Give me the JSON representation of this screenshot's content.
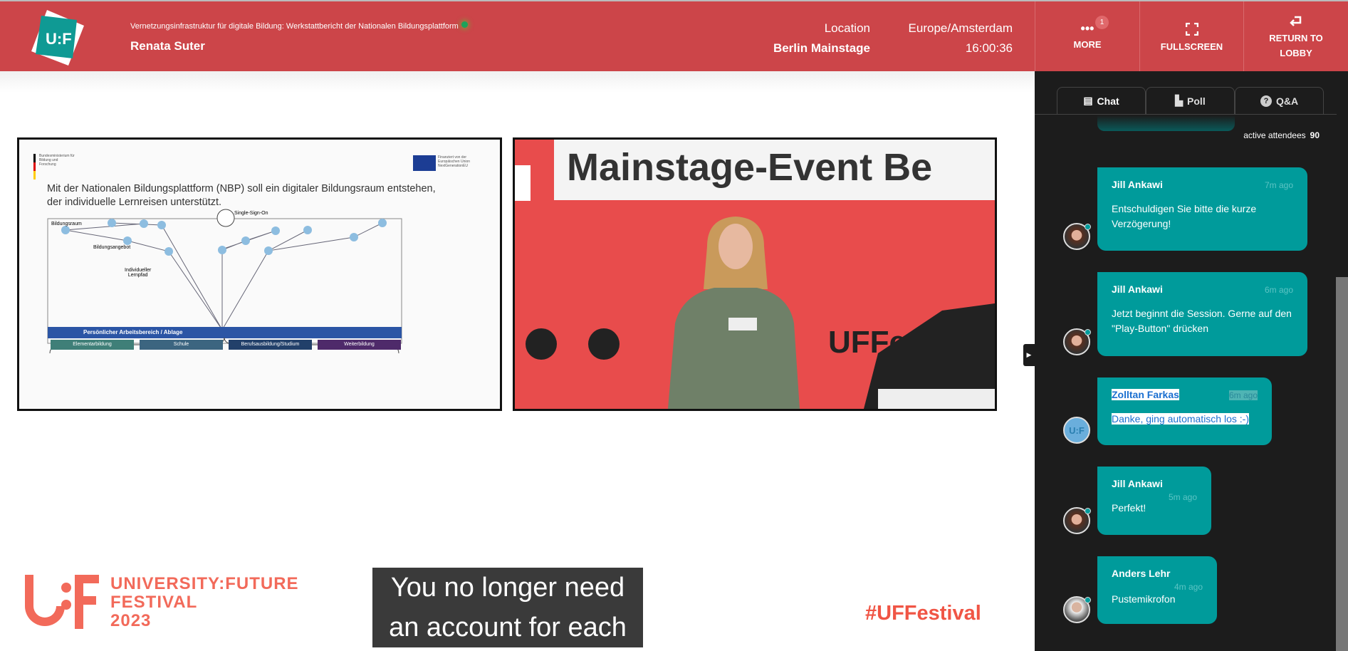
{
  "header": {
    "session_title": "Vernetzungsinfrastruktur für digitale Bildung: Werkstattbericht der Nationalen Bildungsplattform",
    "speaker": "Renata Suter",
    "location_label": "Location",
    "location_value": "Berlin Mainstage",
    "timezone": "Europe/Amsterdam",
    "time": "16:00:36",
    "logo_text": "U:F",
    "buttons": {
      "more": "MORE",
      "more_badge": "1",
      "fullscreen": "FULLSCREEN",
      "return_line1": "RETURN TO",
      "return_line2": "LOBBY"
    }
  },
  "slide": {
    "ministry": "Bundesministerium für Bildung und Forschung",
    "eu": "Finanziert von der Europäischen Union NextGenerationEU",
    "headline_1": "Mit der Nationalen Bildungsplattform (NBP) soll ein digitaler Bildungsraum entstehen,",
    "headline_2": "der individuelle Lernreisen unterstützt.",
    "sso": "Single-Sign-On",
    "space": "Bildungsraum",
    "offer": "Bildungsangebot",
    "path_1": "Individueller",
    "path_2": "Lernpfad",
    "workspace": "Persönlicher Arbeitsbereich / Ablage",
    "categories": [
      {
        "label": "Elementarbildung",
        "color": "#3f7f78"
      },
      {
        "label": "Schule",
        "color": "#3c6580"
      },
      {
        "label": "Berufsausbildung/Studium",
        "color": "#22406a"
      },
      {
        "label": "Weiterbildung",
        "color": "#4e2a6a"
      }
    ]
  },
  "video": {
    "banner": "Mainstage-Event Be",
    "wall_text": "UFFest"
  },
  "stage": {
    "brand_1": "UNIVERSITY:FUTURE",
    "brand_2": "FESTIVAL",
    "brand_3": "2023",
    "caption_1": "You no longer need",
    "caption_2": "an account for each",
    "hashtag": "#UFFestival"
  },
  "sidebar": {
    "tabs": [
      {
        "label": "Chat",
        "icon": "chat-icon"
      },
      {
        "label": "Poll",
        "icon": "bar-chart-icon"
      },
      {
        "label": "Q&A",
        "icon": "question-icon"
      }
    ],
    "active_tab": "Chat",
    "attendees_label": "active attendees",
    "attendees_count": "90",
    "messages": [
      {
        "name": "Jill Ankawi",
        "time": "7m ago",
        "text": "Entschuldigen Sie bitte die kurze Verzögerung!"
      },
      {
        "name": "Jill Ankawi",
        "time": "6m ago",
        "text": "Jetzt beginnt die Session. Gerne auf den \"Play-Button\" drücken"
      },
      {
        "name": "Zolltan Farkas",
        "time": "6m ago",
        "text": "Danke, ging automatisch los :-)"
      },
      {
        "name": "Jill Ankawi",
        "time": "5m ago",
        "text": "Perfekt!"
      },
      {
        "name": "Anders Lehr",
        "time": "4m ago",
        "text": "Pustemikrofon"
      }
    ]
  },
  "colors": {
    "brand_red": "#cc4549",
    "teal": "#009b9b",
    "sidebar_bg": "#1c1c1c"
  }
}
